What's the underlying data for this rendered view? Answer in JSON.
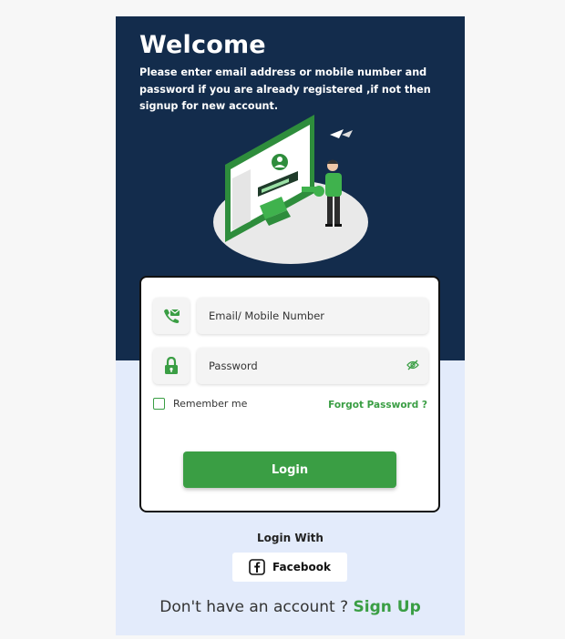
{
  "header": {
    "title": "Welcome",
    "subtitle": "Please enter email address or mobile number and password if you are already registered ,if not then signup for new account."
  },
  "form": {
    "email_placeholder": "Email/ Mobile Number",
    "password_placeholder": "Password",
    "remember_label": "Remember me",
    "remember_checked": false,
    "forgot_label": "Forgot Password ?",
    "login_label": "Login"
  },
  "social": {
    "heading": "Login With",
    "facebook_label": "Facebook"
  },
  "footer": {
    "prompt": "Don't have an account ?",
    "signup_label": "Sign Up"
  },
  "colors": {
    "header_bg": "#132c4c",
    "page_bg": "#e3ebfb",
    "accent": "#3a9e44"
  },
  "icons": {
    "email": "phone-mail-icon",
    "password": "lock-icon",
    "visibility": "eye-off-icon",
    "facebook": "facebook-icon"
  }
}
